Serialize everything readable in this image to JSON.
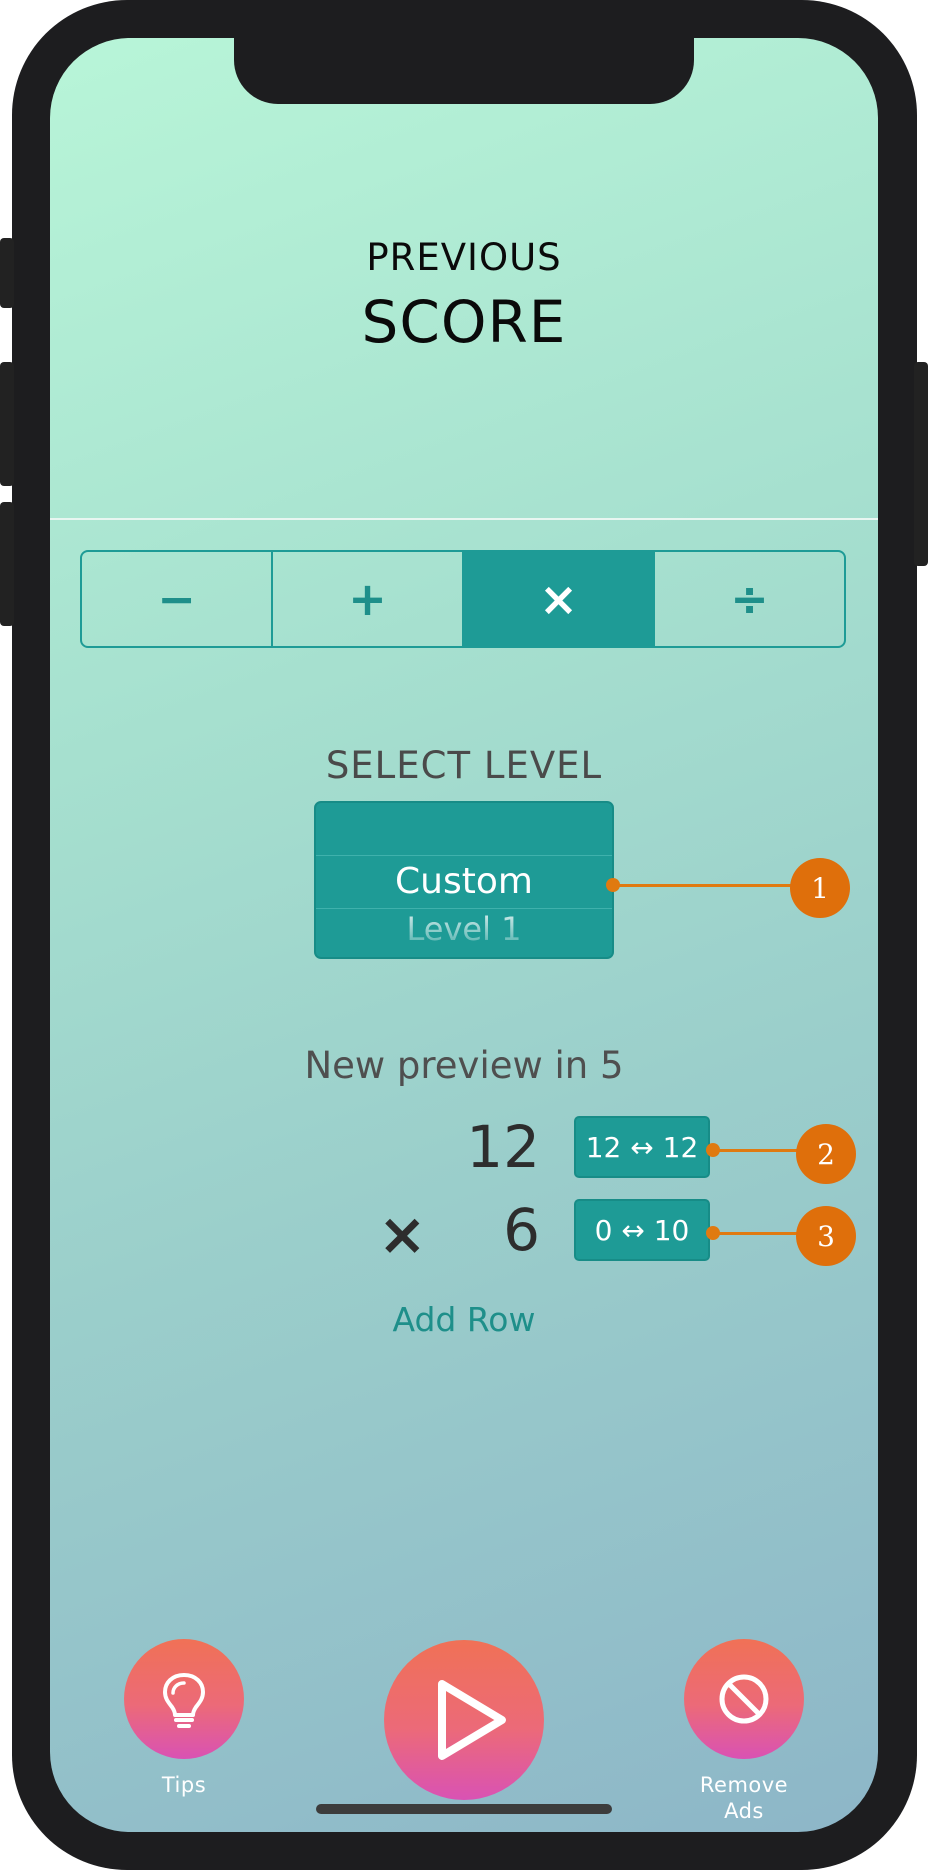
{
  "header": {
    "title_line1": "PREVIOUS",
    "title_line2": "SCORE"
  },
  "operations": {
    "items": [
      {
        "symbol": "−",
        "name": "subtract"
      },
      {
        "symbol": "+",
        "name": "add"
      },
      {
        "symbol": "×",
        "name": "multiply"
      },
      {
        "symbol": "÷",
        "name": "divide"
      }
    ],
    "selected": "×"
  },
  "level": {
    "label": "SELECT LEVEL",
    "selected": "Custom",
    "next": "Level 1"
  },
  "preview": {
    "text": "New preview in 5",
    "rows": [
      {
        "operator": "",
        "value": "12",
        "range": "12 ↔ 12"
      },
      {
        "operator": "×",
        "value": "6",
        "range": "0 ↔ 10"
      }
    ],
    "add_row_label": "Add Row"
  },
  "callouts": [
    "1",
    "2",
    "3"
  ],
  "bottom_bar": {
    "tips_label": "Tips",
    "remove_ads_label_line1": "Remove",
    "remove_ads_label_line2": "Ads",
    "tips_icon": "lightbulb-icon",
    "play_icon": "play-icon",
    "remove_ads_icon": "prohibited-icon"
  },
  "colors": {
    "accent": "#1e9b96",
    "callout": "#df6f0b",
    "button_top": "#f07156",
    "button_bottom": "#d952b4"
  }
}
